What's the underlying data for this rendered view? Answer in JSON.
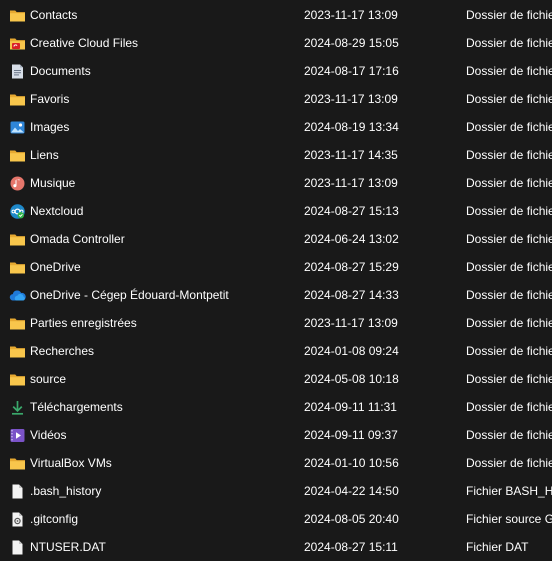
{
  "files": [
    {
      "name": "Contacts",
      "date": "2023-11-17 13:09",
      "type": "Dossier de fichiers",
      "icon": "folder-icon"
    },
    {
      "name": "Creative Cloud Files",
      "date": "2024-08-29 15:05",
      "type": "Dossier de fichiers",
      "icon": "creative-cloud-folder-icon"
    },
    {
      "name": "Documents",
      "date": "2024-08-17 17:16",
      "type": "Dossier de fichiers",
      "icon": "documents-icon"
    },
    {
      "name": "Favoris",
      "date": "2023-11-17 13:09",
      "type": "Dossier de fichiers",
      "icon": "folder-icon"
    },
    {
      "name": "Images",
      "date": "2024-08-19 13:34",
      "type": "Dossier de fichiers",
      "icon": "images-icon"
    },
    {
      "name": "Liens",
      "date": "2023-11-17 14:35",
      "type": "Dossier de fichiers",
      "icon": "folder-icon"
    },
    {
      "name": "Musique",
      "date": "2023-11-17 13:09",
      "type": "Dossier de fichiers",
      "icon": "music-icon"
    },
    {
      "name": "Nextcloud",
      "date": "2024-08-27 15:13",
      "type": "Dossier de fichiers",
      "icon": "nextcloud-icon"
    },
    {
      "name": "Omada Controller",
      "date": "2024-06-24 13:02",
      "type": "Dossier de fichiers",
      "icon": "folder-icon"
    },
    {
      "name": "OneDrive",
      "date": "2024-08-27 15:29",
      "type": "Dossier de fichiers",
      "icon": "folder-icon"
    },
    {
      "name": "OneDrive - Cégep Édouard-Montpetit",
      "date": "2024-08-27 14:33",
      "type": "Dossier de fichiers",
      "icon": "onedrive-cloud-icon"
    },
    {
      "name": "Parties enregistrées",
      "date": "2023-11-17 13:09",
      "type": "Dossier de fichiers",
      "icon": "folder-icon"
    },
    {
      "name": "Recherches",
      "date": "2024-01-08 09:24",
      "type": "Dossier de fichiers",
      "icon": "folder-icon"
    },
    {
      "name": "source",
      "date": "2024-05-08 10:18",
      "type": "Dossier de fichiers",
      "icon": "folder-icon"
    },
    {
      "name": "Téléchargements",
      "date": "2024-09-11 11:31",
      "type": "Dossier de fichiers",
      "icon": "download-icon"
    },
    {
      "name": "Vidéos",
      "date": "2024-09-11 09:37",
      "type": "Dossier de fichiers",
      "icon": "video-icon"
    },
    {
      "name": "VirtualBox VMs",
      "date": "2024-01-10 10:56",
      "type": "Dossier de fichiers",
      "icon": "folder-icon"
    },
    {
      "name": ".bash_history",
      "date": "2024-04-22 14:50",
      "type": "Fichier BASH_HISTORY",
      "icon": "file-icon"
    },
    {
      "name": ".gitconfig",
      "date": "2024-08-05 20:40",
      "type": "Fichier source Git",
      "icon": "config-file-icon"
    },
    {
      "name": "NTUSER.DAT",
      "date": "2024-08-27 15:11",
      "type": "Fichier DAT",
      "icon": "file-icon"
    }
  ]
}
